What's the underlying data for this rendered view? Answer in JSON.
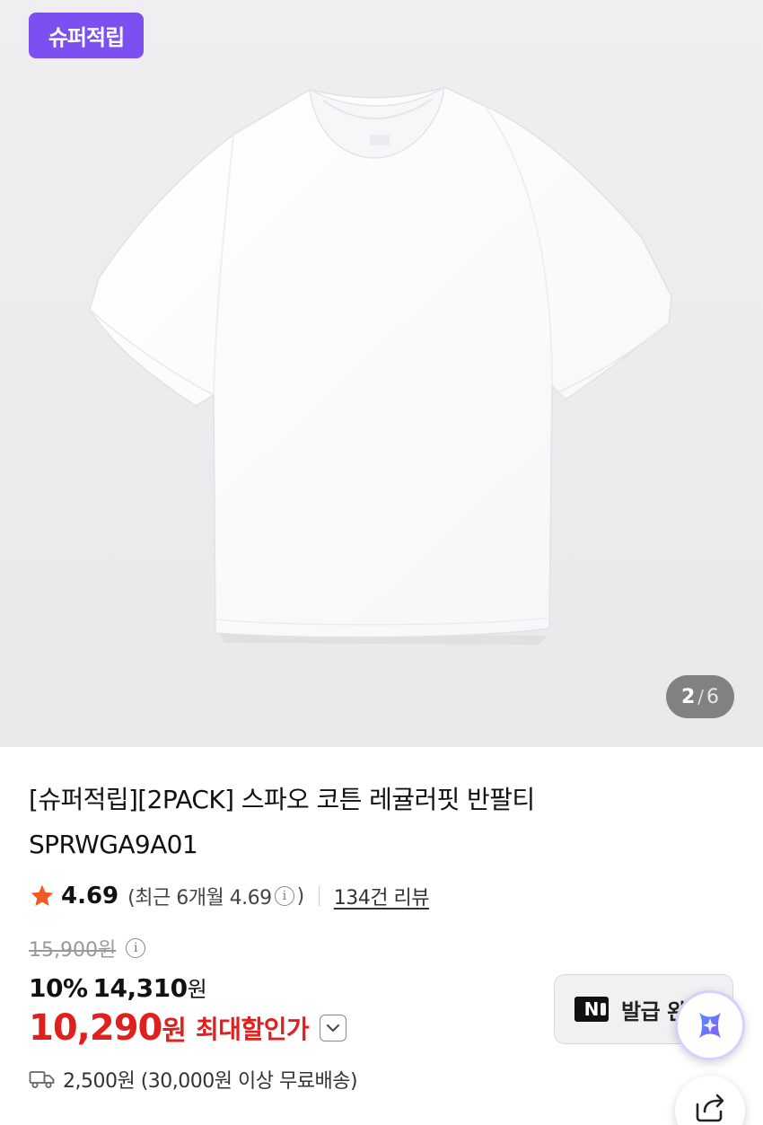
{
  "product": {
    "badge": "슈퍼적립",
    "image_counter": {
      "current": "2",
      "separator": "/",
      "total": "6"
    },
    "title_line1": "[슈퍼적립][2PACK] 스파오 코튼 레귤러핏 반팔티",
    "title_line2": "SPRWGA9A01"
  },
  "rating": {
    "score": "4.69",
    "recent_prefix": "(최근 6개월 4.69",
    "recent_suffix": ")",
    "reviews_link": "134건 리뷰",
    "star_color": "#f15a24"
  },
  "price": {
    "original": "15,900원",
    "discount_percent": "10%",
    "sale_price": "14,310",
    "sale_won": "원",
    "max_price": "10,290",
    "max_won": "원",
    "max_label": "최대할인가",
    "accent_color": "#e0201f"
  },
  "shipping": {
    "text": "2,500원 (30,000원 이상 무료배송)"
  },
  "coupon": {
    "logo": "N",
    "label": "발급 완"
  },
  "colors": {
    "badge_bg": "#7b4ff0",
    "hero_bg": "#eeeef0"
  },
  "icons": [
    "star-icon",
    "info-icon",
    "chevron-down-icon",
    "truck-icon",
    "ai-sparkle-icon",
    "share-icon"
  ]
}
